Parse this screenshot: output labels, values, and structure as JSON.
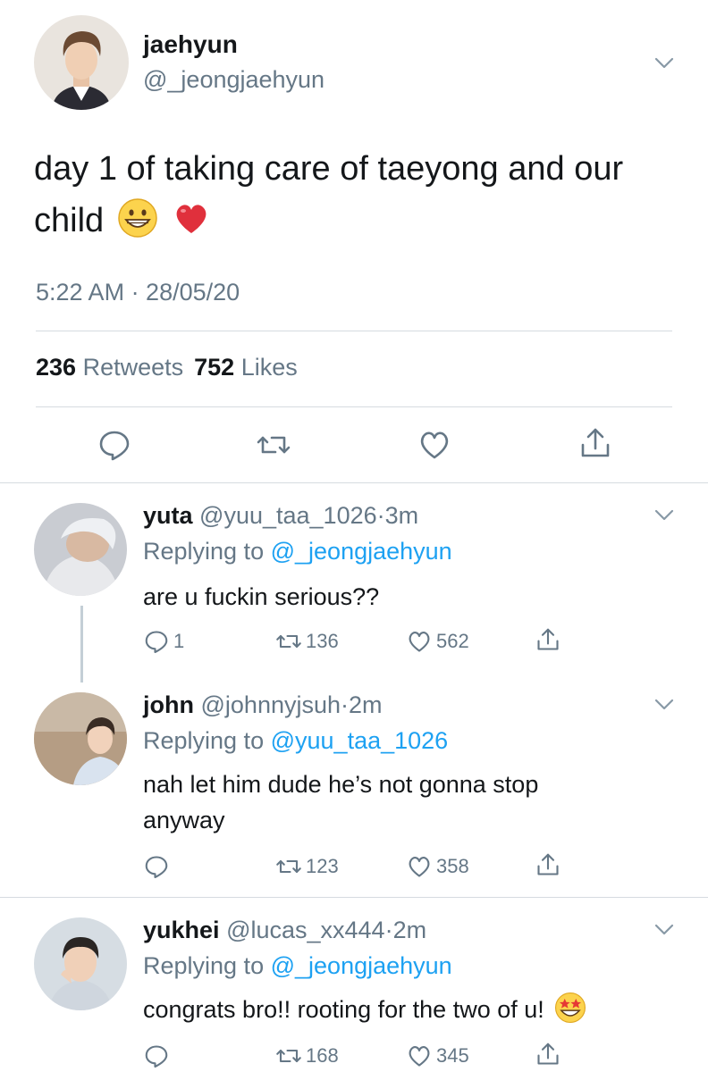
{
  "colors": {
    "text": "#14171a",
    "secondary": "#657786",
    "link": "#1da1f2",
    "divider": "#d6dbe0"
  },
  "main_tweet": {
    "name": "jaehyun",
    "handle": "@_jeongjaehyun",
    "text": "day 1 of taking care of taeyong and our child",
    "emojis": [
      "grinning-face-icon",
      "red-heart-icon"
    ],
    "timestamp": "5:22 AM · 28/05/20",
    "retweets_count": "236",
    "retweets_label": "Retweets",
    "likes_count": "752",
    "likes_label": "Likes",
    "actions": [
      "reply-icon",
      "retweet-icon",
      "like-icon",
      "share-icon"
    ]
  },
  "replies": [
    {
      "name": "yuta",
      "handle": "@yuu_taa_1026",
      "time": "3m",
      "replying_label": "Replying to",
      "replying_to": "@_jeongjaehyun",
      "text": "are u fuckin serious??",
      "reply_count": "1",
      "retweet_count": "136",
      "like_count": "562"
    },
    {
      "name": "john",
      "handle": "@johnnyjsuh",
      "time": "2m",
      "replying_label": "Replying to",
      "replying_to": "@yuu_taa_1026",
      "text": "nah let him dude he’s not gonna stop anyway",
      "reply_count": "",
      "retweet_count": "123",
      "like_count": "358"
    },
    {
      "name": "yukhei",
      "handle": "@lucas_xx444",
      "time": "2m",
      "replying_label": "Replying to",
      "replying_to": "@_jeongjaehyun",
      "text": "congrats bro!! rooting for the two of u!",
      "emoji": "star-struck-icon",
      "reply_count": "",
      "retweet_count": "168",
      "like_count": "345"
    }
  ]
}
